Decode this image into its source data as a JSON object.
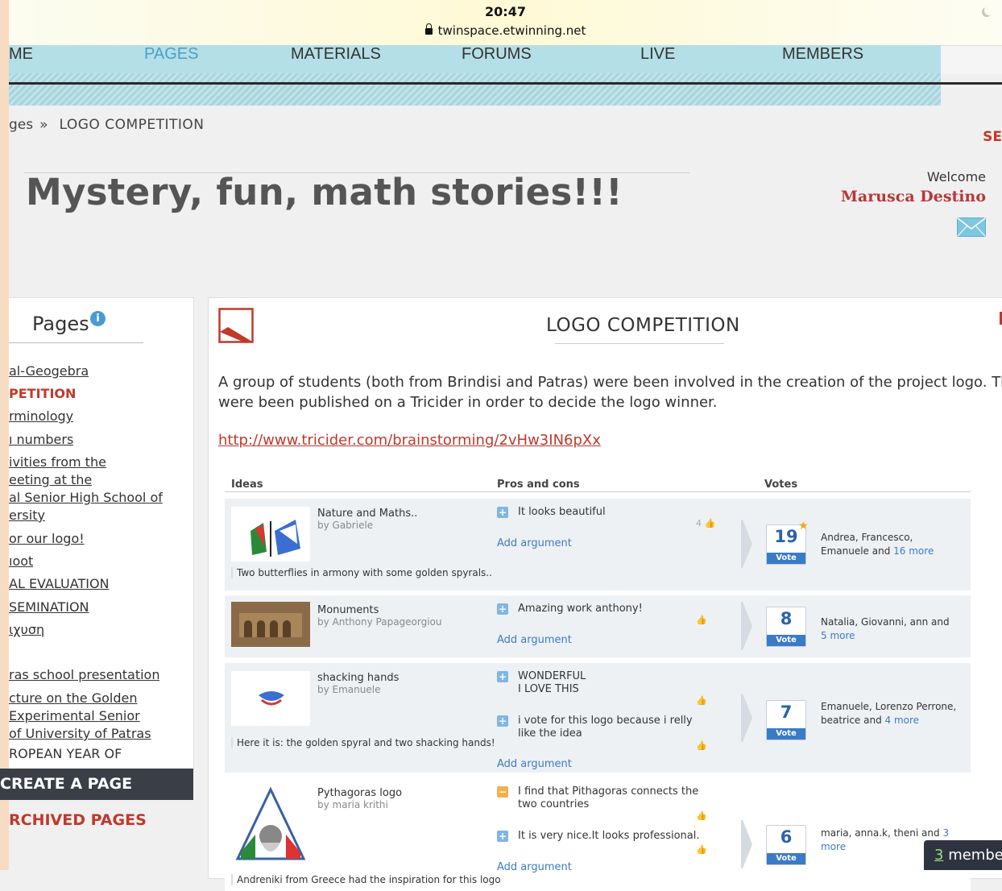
{
  "status": {
    "time": "20:47",
    "url": "twinspace.etwinning.net"
  },
  "nav": {
    "items": [
      "ME",
      "PAGES",
      "MATERIALS",
      "FORUMS",
      "LIVE",
      "MEMBERS"
    ],
    "active": "PAGES"
  },
  "breadcrumb": {
    "prev": "ges",
    "sep": "»",
    "current": "LOGO COMPETITION"
  },
  "se_fragment": "SE",
  "page_title": "Mystery, fun, math stories!!!",
  "welcome": {
    "label": "Welcome",
    "name": "Marusca Destino"
  },
  "sidebar": {
    "heading": "Pages",
    "items": [
      {
        "label": "al-Geogebra"
      },
      {
        "label": "PETITION",
        "active": true
      },
      {
        "label": "rminology"
      },
      {
        "label": "ı numbers"
      },
      {
        "label": "ivities from the"
      },
      {
        "label": "eeting at the"
      },
      {
        "label": "al Senior High School of"
      },
      {
        "label": "ersity"
      },
      {
        "label": "or our logo!"
      },
      {
        "label": "ıoot"
      },
      {
        "label": "AL EVALUATION"
      },
      {
        "label": "SEMINATION"
      },
      {
        "label": "ιχυση"
      },
      {
        "label": "ras school presentation"
      },
      {
        "label": "cture on the Golden"
      },
      {
        "label": "Experimental Senior"
      },
      {
        "label": "of University of Patras"
      },
      {
        "label": "ROPEAN YEAR OF"
      }
    ],
    "create_button": "CREATE A PAGE",
    "archived": "RCHIVED PAGES"
  },
  "card": {
    "title": "LOGO COMPETITION",
    "description_line1": "A group of students (both from Brindisi and Patras) were been involved in the creation of the project logo. Th",
    "description_line2": "were been published on a Tricider in order to decide the logo winner.",
    "link": "http://www.tricider.com/brainstorming/2vHw3IN6pXx"
  },
  "tricider": {
    "headers": {
      "ideas": "Ideas",
      "pros_cons": "Pros and cons",
      "votes": "Votes"
    },
    "rows": [
      {
        "title": "Nature and Maths..",
        "by": "by Gabriele",
        "desc": "Two butterflies in armony with some golden spyrals..",
        "args": [
          {
            "type": "pro",
            "text": "It looks beautiful",
            "likes": "4"
          }
        ],
        "add": "Add argument",
        "votes": "19",
        "vote_label": "Vote",
        "starred": true,
        "voters": "Andrea, Francesco, Emanuele and",
        "more": "16 more"
      },
      {
        "title": "Monuments",
        "by": "by Anthony Papageorgiou",
        "desc": "",
        "args": [
          {
            "type": "pro",
            "text": "Amazing work anthony!",
            "likes": ""
          }
        ],
        "add": "Add argument",
        "votes": "8",
        "vote_label": "Vote",
        "starred": false,
        "voters": "Natalia, Giovanni, ann and",
        "more": "5 more"
      },
      {
        "title": "shacking hands",
        "by": "by Emanuele",
        "desc": "Here it is: the golden spyral and two shacking hands!",
        "args": [
          {
            "type": "pro",
            "text": "WONDERFUL I LOVE THIS",
            "likes": ""
          },
          {
            "type": "pro",
            "text": "i vote for this logo because i relly like the idea",
            "likes": ""
          }
        ],
        "add": "Add argument",
        "votes": "7",
        "vote_label": "Vote",
        "starred": false,
        "voters": "Emanuele, Lorenzo Perrone, beatrice and",
        "more": "4 more"
      },
      {
        "title": "Pythagoras logo",
        "by": "by maria krithi",
        "desc": "Andreniki from Greece had the inspiration for this logo",
        "args": [
          {
            "type": "con",
            "text": "I find that Pithagoras connects the two countries",
            "likes": ""
          },
          {
            "type": "pro",
            "text": "It is very nice.It looks professional.",
            "likes": ""
          }
        ],
        "add": "Add argument",
        "votes": "6",
        "vote_label": "Vote",
        "starred": false,
        "voters": "maria, anna.k, theni and",
        "more": "3 more"
      }
    ]
  },
  "members_button": {
    "count": "3",
    "label": "membe"
  },
  "colors": {
    "accent": "#4aa0c9",
    "red": "#c0392b",
    "nav_bg": "#b4dfe6",
    "vote_blue": "#3a7bc8"
  }
}
